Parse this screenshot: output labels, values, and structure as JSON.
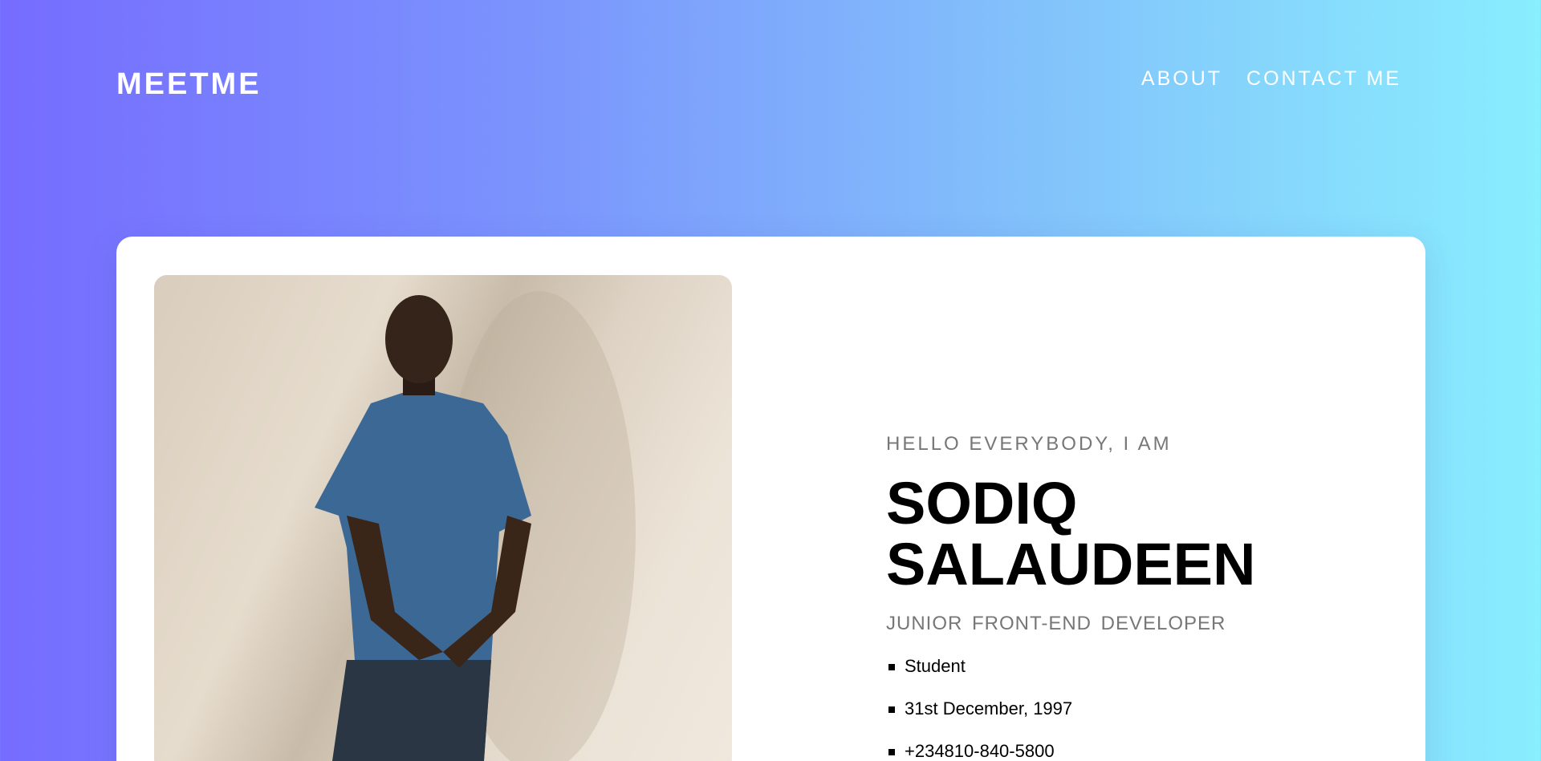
{
  "header": {
    "logo": "MEETME",
    "nav": [
      "ABOUT",
      "CONTACT ME"
    ]
  },
  "profile": {
    "greeting": "HELLO EVERYBODY, I AM",
    "name_line1": "SODIQ",
    "name_line2": "SALAUDEEN",
    "role": "JUNIOR FRONT-END DEVELOPER",
    "details": [
      "Student",
      "31st December, 1997",
      "+234810-840-5800"
    ]
  }
}
